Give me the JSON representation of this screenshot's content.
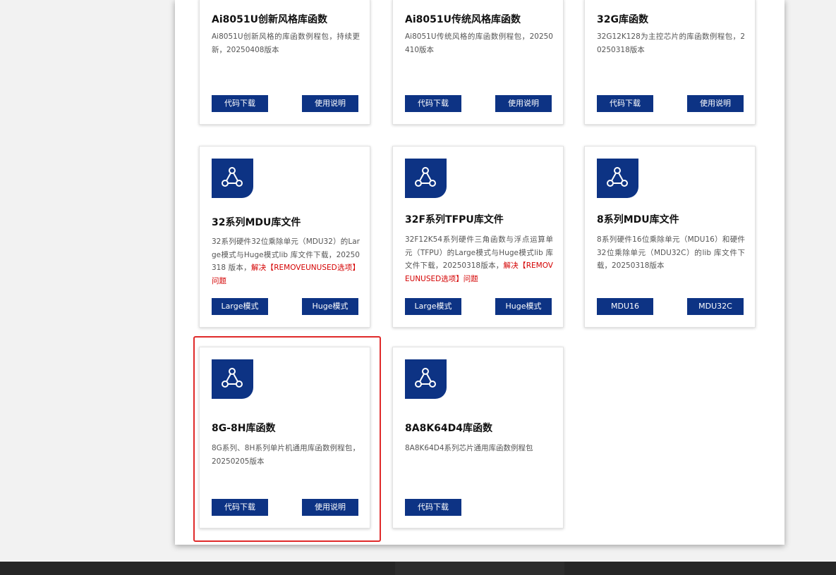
{
  "colors": {
    "brand": "#0d3384",
    "highlight_text": "#d40000",
    "selection_border": "#e02a2a"
  },
  "cards": [
    {
      "title": "Ai8051U创新风格库函数",
      "desc": "Ai8051U创新风格的库函数例程包，持续更新，20250408版本",
      "buttons": [
        "代码下载",
        "使用说明"
      ]
    },
    {
      "title": "Ai8051U传统风格库函数",
      "desc": "Ai8051U传统风格的库函数例程包，20250410版本",
      "buttons": [
        "代码下载",
        "使用说明"
      ]
    },
    {
      "title": "32G库函数",
      "desc": "32G12K128为主控芯片的库函数例程包，20250318版本",
      "buttons": [
        "代码下载",
        "使用说明"
      ]
    },
    {
      "title": "32系列MDU库文件",
      "desc": "32系列硬件32位乘除单元（MDU32）的Large模式与Huge模式lib 库文件下载，20250318 版本，",
      "desc_highlight": "解决【REMOVEUNUSED选项】问题",
      "buttons": [
        "Large模式",
        "Huge模式"
      ],
      "icon": "network-triangle-icon"
    },
    {
      "title": "32F系列TFPU库文件",
      "desc": "32F12K54系列硬件三角函数与浮点运算单元（TFPU）的Large模式与Huge模式lib 库文件下载，20250318版本，",
      "desc_highlight": "解决【REMOVEUNUSED选项】问题",
      "buttons": [
        "Large模式",
        "Huge模式"
      ],
      "icon": "network-triangle-icon"
    },
    {
      "title": "8系列MDU库文件",
      "desc": "8系列硬件16位乘除单元（MDU16）和硬件32位乘除单元（MDU32C）的lib 库文件下载，20250318版本",
      "buttons": [
        "MDU16",
        "MDU32C"
      ],
      "icon": "network-triangle-icon"
    },
    {
      "title": "8G-8H库函数",
      "desc": "8G系列、8H系列单片机通用库函数例程包，20250205版本",
      "buttons": [
        "代码下载",
        "使用说明"
      ],
      "icon": "network-triangle-icon"
    },
    {
      "title": "8A8K64D4库函数",
      "desc": "8A8K64D4系列芯片通用库函数例程包",
      "buttons": [
        "代码下载"
      ],
      "icon": "network-triangle-icon"
    }
  ]
}
